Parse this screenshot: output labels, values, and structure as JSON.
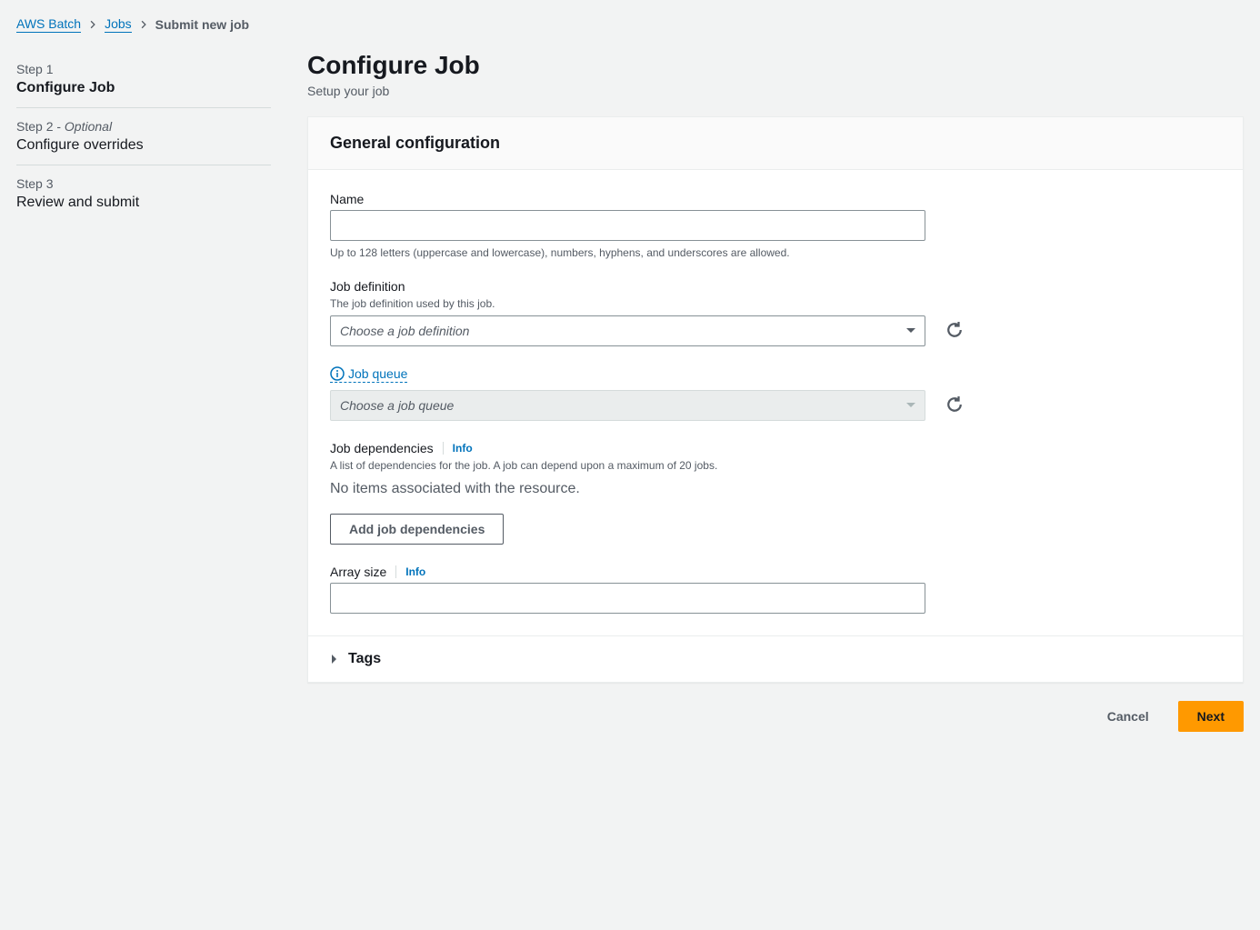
{
  "breadcrumb": {
    "level1": "AWS Batch",
    "level2": "Jobs",
    "current": "Submit new job"
  },
  "sidebar": {
    "steps": [
      {
        "label": "Step 1",
        "title": "Configure Job",
        "active": true
      },
      {
        "label": "Step 2 - ",
        "optional": "Optional",
        "title": "Configure overrides",
        "active": false
      },
      {
        "label": "Step 3",
        "title": "Review and submit",
        "active": false
      }
    ]
  },
  "header": {
    "title": "Configure Job",
    "subtitle": "Setup your job"
  },
  "panel": {
    "title": "General configuration"
  },
  "fields": {
    "name": {
      "label": "Name",
      "value": "",
      "hint": "Up to 128 letters (uppercase and lowercase), numbers, hyphens, and underscores are allowed."
    },
    "job_definition": {
      "label": "Job definition",
      "desc": "The job definition used by this job.",
      "placeholder": "Choose a job definition"
    },
    "job_queue": {
      "label": "Job queue",
      "placeholder": "Choose a job queue"
    },
    "job_dependencies": {
      "label": "Job dependencies",
      "info": "Info",
      "desc": "A list of dependencies for the job. A job can depend upon a maximum of 20 jobs.",
      "empty": "No items associated with the resource.",
      "add_button": "Add job dependencies"
    },
    "array_size": {
      "label": "Array size",
      "info": "Info",
      "value": ""
    }
  },
  "expandable": {
    "tags": "Tags"
  },
  "footer": {
    "cancel": "Cancel",
    "next": "Next"
  }
}
